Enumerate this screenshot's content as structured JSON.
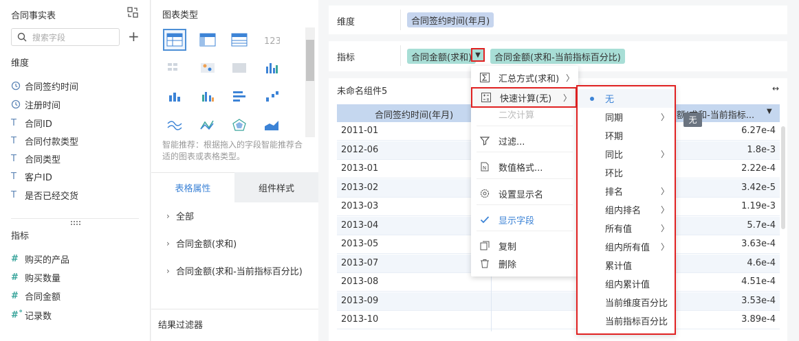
{
  "dataset": {
    "title": "合同事实表",
    "search_placeholder": "搜索字段",
    "dimension_header": "维度",
    "dimensions": [
      {
        "label": "合同签约时间",
        "icon": "clock-icon"
      },
      {
        "label": "注册时间",
        "icon": "clock-icon"
      },
      {
        "label": "合同ID",
        "icon": "text-type-icon"
      },
      {
        "label": "合同付款类型",
        "icon": "text-type-icon"
      },
      {
        "label": "合同类型",
        "icon": "text-type-icon"
      },
      {
        "label": "客户ID",
        "icon": "text-type-icon"
      },
      {
        "label": "是否已经交货",
        "icon": "text-type-icon"
      }
    ],
    "metric_header": "指标",
    "metrics": [
      {
        "label": "购买的产品",
        "icon": "number-type-icon"
      },
      {
        "label": "购买数量",
        "icon": "number-type-icon"
      },
      {
        "label": "合同金额",
        "icon": "number-type-icon"
      },
      {
        "label": "记录数",
        "icon": "record-count-icon"
      }
    ]
  },
  "chart_panel": {
    "title": "图表类型",
    "hint": "智能推荐：根据拖入的字段智能推荐合适的图表或表格类型。",
    "tabs": [
      "表格属性",
      "组件样式"
    ],
    "properties": [
      "全部",
      "合同金额(求和)",
      "合同金额(求和-当前指标百分比)"
    ],
    "filter_title": "结果过滤器"
  },
  "dimension_row": {
    "label": "维度",
    "pill": "合同签约时间(年月)"
  },
  "metric_row": {
    "label": "指标",
    "pills": [
      "合同金额(求和)",
      "合同金额(求和-当前指标百分比)"
    ]
  },
  "widget": {
    "title": "未命名组件5",
    "columns": [
      "合同签约时间(年月)",
      "额(求和-当前指标..."
    ],
    "rows": [
      {
        "date": "2011-01",
        "value": "6.27e-4"
      },
      {
        "date": "2012-06",
        "value": "1.8e-3"
      },
      {
        "date": "2013-01",
        "value": "2.22e-4"
      },
      {
        "date": "2013-02",
        "value": "3.42e-5"
      },
      {
        "date": "2013-03",
        "value": "1.19e-3"
      },
      {
        "date": "2013-04",
        "value": "5.7e-4"
      },
      {
        "date": "2013-05",
        "value": "3.63e-4"
      },
      {
        "date": "2013-07",
        "value": "4.6e-4"
      },
      {
        "date": "2013-08",
        "value": "4.51e-4"
      },
      {
        "date": "2013-09",
        "value": "3.53e-4"
      },
      {
        "date": "2013-10",
        "value": "3.89e-4"
      }
    ]
  },
  "context_menu": {
    "items": [
      {
        "label": "汇总方式(求和)",
        "icon": "sigma-icon",
        "arrow": true
      },
      {
        "label": "快速计算(无)",
        "icon": "calculator-icon",
        "arrow": true
      },
      {
        "label": "二次计算",
        "icon": "",
        "arrow": false
      },
      {
        "label": "过滤...",
        "icon": "filter-icon",
        "arrow": false
      },
      {
        "label": "数值格式...",
        "icon": "number-format-icon",
        "arrow": false
      },
      {
        "label": "设置显示名",
        "icon": "gear-icon",
        "arrow": false
      },
      {
        "label": "显示字段",
        "icon": "check-icon",
        "arrow": false
      },
      {
        "label": "复制",
        "icon": "copy-icon",
        "arrow": false
      },
      {
        "label": "删除",
        "icon": "trash-icon",
        "arrow": false
      }
    ]
  },
  "quick_calc_menu": {
    "items": [
      {
        "label": "无",
        "arrow": false,
        "selected": true
      },
      {
        "label": "同期",
        "arrow": true
      },
      {
        "label": "环期",
        "arrow": false
      },
      {
        "label": "同比",
        "arrow": true
      },
      {
        "label": "环比",
        "arrow": false
      },
      {
        "label": "排名",
        "arrow": true
      },
      {
        "label": "组内排名",
        "arrow": true
      },
      {
        "label": "所有值",
        "arrow": true
      },
      {
        "label": "组内所有值",
        "arrow": true
      },
      {
        "label": "累计值",
        "arrow": false
      },
      {
        "label": "组内累计值",
        "arrow": false
      },
      {
        "label": "当前维度百分比",
        "arrow": false
      },
      {
        "label": "当前指标百分比",
        "arrow": false
      }
    ],
    "tooltip": "无"
  },
  "colors": {
    "accent": "#3c83d6",
    "highlight": "#e02020",
    "dim_pill": "#c6d5ee",
    "metric_pill": "#a8ded6"
  }
}
